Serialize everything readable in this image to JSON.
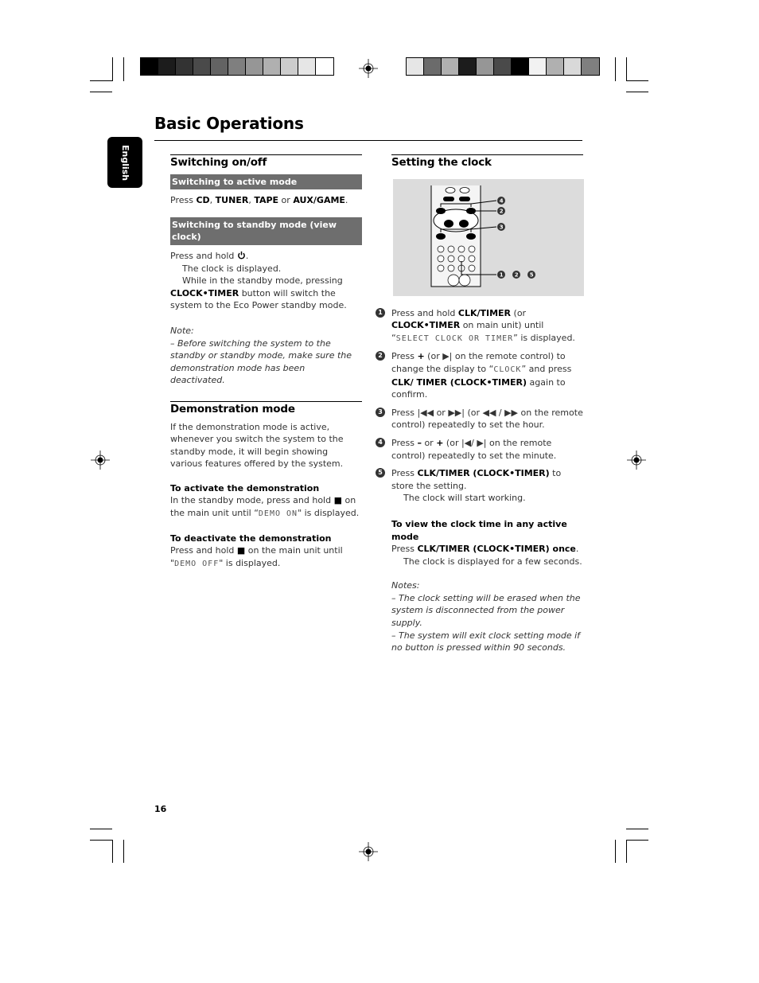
{
  "page": {
    "title": "Basic Operations",
    "language_tab": "English",
    "page_number": "16"
  },
  "print_marks": {
    "left_swatches": [
      "#000000",
      "#1c1c1c",
      "#333333",
      "#4a4a4a",
      "#636363",
      "#7f7f7f",
      "#969696",
      "#b0b0b0",
      "#cccccc",
      "#e6e6e6",
      "#ffffff"
    ],
    "right_swatches": [
      "#e6e6e6",
      "#6b6b6b",
      "#b0b0b0",
      "#1c1c1c",
      "#969696",
      "#4a4a4a",
      "#000000",
      "#f2f2f2",
      "#b0b0b0",
      "#d9d9d9",
      "#7f7f7f"
    ]
  },
  "left": {
    "switching": {
      "heading": "Switching on/off",
      "active_bar": "Switching to active mode",
      "active_text": {
        "pre": "Press ",
        "cd": "CD",
        "sep1": ", ",
        "tuner": "TUNER",
        "sep2": ", ",
        "tape": "TAPE",
        "or": " or ",
        "aux": "AUX/GAME",
        "end": "."
      },
      "standby_bar": "Switching to standby mode (view clock)",
      "standby_press": "Press and hold",
      "power_icon": "power-icon",
      "standby_line1": "The clock is displayed.",
      "standby_line2": "While in the standby mode, pressing",
      "standby_bold": "CLOCK•TIMER",
      "standby_rest": " button will switch the system to the Eco Power standby mode.",
      "note_label": "Note:",
      "note_text": "–  Before switching the system to the standby or standby mode, make sure the demonstration mode has been deactivated."
    },
    "demo": {
      "heading": "Demonstration mode",
      "intro": "If the demonstration mode is active, whenever you switch the system to the standby mode, it will begin showing various features offered by the system.",
      "activate_title": "To activate the demonstration",
      "activate_pre": "In the standby mode, press and hold ",
      "activate_mid": " on the main unit until “",
      "activate_lcd": "DEMO ON",
      "activate_end": "\" is displayed.",
      "deactivate_title": "To deactivate the demonstration",
      "deactivate_pre": "Press and hold ",
      "deactivate_mid": " on the main unit until \"",
      "deactivate_lcd": "DEMO OFF",
      "deactivate_end": "\" is displayed.",
      "stop_icon": "■"
    }
  },
  "right": {
    "heading": "Setting the clock",
    "figure_callouts": [
      "4",
      "2",
      "3",
      "1",
      "2",
      "5"
    ],
    "steps": [
      {
        "n": "1",
        "a": "Press and hold ",
        "b1": "CLK/TIMER",
        "c": " (or ",
        "b2": "CLOCK•TIMER",
        "d": " on main unit) until “",
        "lcd": "SELECT CLOCK OR TIMER",
        "e": "” is displayed."
      },
      {
        "n": "2",
        "a": "Press ",
        "b1": "+",
        "c": " (or ▶| on the remote control) to change the display to “",
        "lcd": "CLOCK",
        "d": "” and press ",
        "b2": "CLK/ TIMER (CLOCK•TIMER)",
        "e": " again to confirm."
      },
      {
        "n": "3",
        "text": "Press |◀◀ or ▶▶| (or ◀◀ / ▶▶  on the remote control) repeatedly to set the hour."
      },
      {
        "n": "4",
        "a": "Press ",
        "b1": "–",
        "c": " or ",
        "b2": "+",
        "d": " (or |◀/ ▶| on the remote control) repeatedly to set the minute."
      },
      {
        "n": "5",
        "a": "Press ",
        "b1": "CLK/TIMER (CLOCK•TIMER)",
        "c": " to store the setting.",
        "d": "The clock will start working."
      }
    ],
    "view": {
      "title": "To view the clock time in any active mode",
      "pre": "Press ",
      "bold": "CLK/TIMER (CLOCK•TIMER) once",
      "end": ".",
      "result": "The clock is displayed for a few seconds."
    },
    "notes_label": "Notes:",
    "notes": [
      "–  The clock setting will be erased when the system is disconnected from the power supply.",
      "–  The system will exit clock setting mode if no button is pressed within 90 seconds."
    ]
  }
}
